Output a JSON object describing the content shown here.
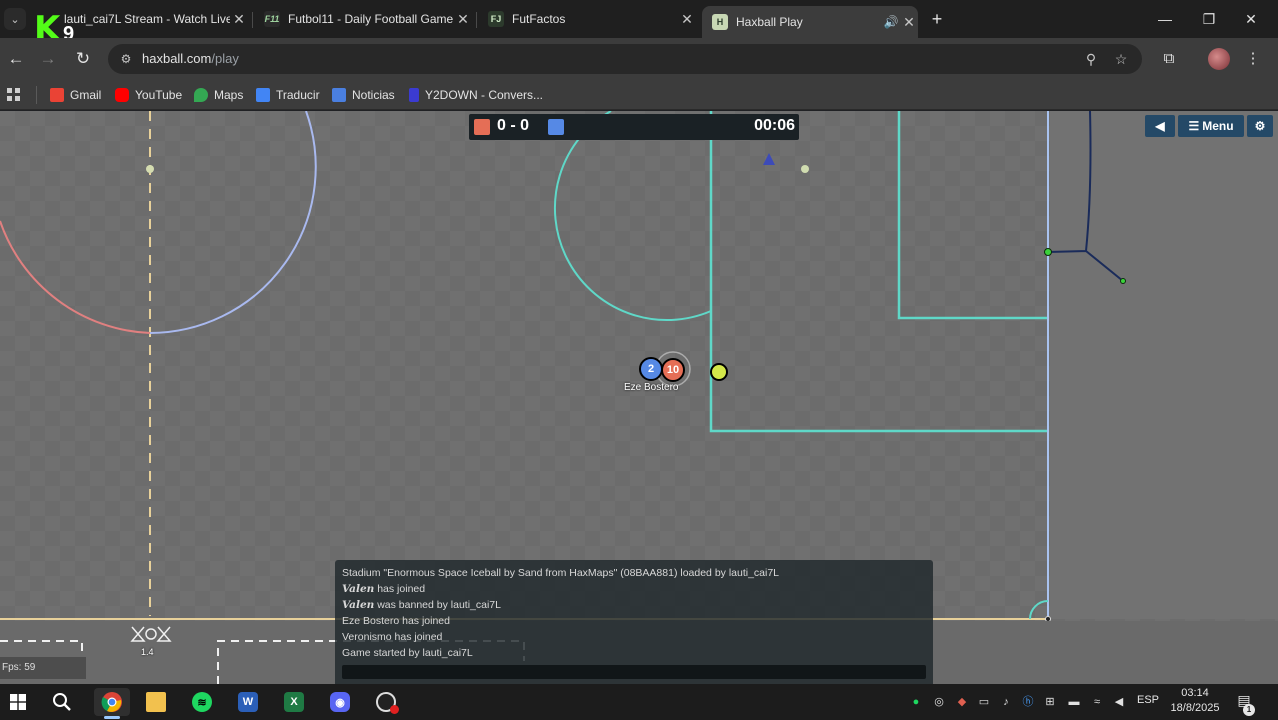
{
  "browser": {
    "tabs": [
      {
        "title": "lauti_cai7L Stream - Watch Live",
        "favicon": "kick-icon",
        "active": false
      },
      {
        "title": "Futbol11 - Daily Football Game",
        "favicon": "futbol11-icon",
        "active": false
      },
      {
        "title": "FutFactos",
        "favicon": "futfactos-icon",
        "active": false
      },
      {
        "title": "Haxball Play",
        "favicon": "haxball-icon",
        "active": true
      }
    ],
    "overlay_number": "9",
    "url_host": "haxball.com",
    "url_path": "/play",
    "bookmarks": [
      {
        "label": "Gmail",
        "color": "#ea4335"
      },
      {
        "label": "YouTube",
        "color": "#ff0000"
      },
      {
        "label": "Maps",
        "color": "#34a853"
      },
      {
        "label": "Traducir",
        "color": "#4285f4"
      },
      {
        "label": "Noticias",
        "color": "#4a7fe0"
      },
      {
        "label": "Y2DOWN - Convers...",
        "color": "#3b3bd1"
      }
    ]
  },
  "game": {
    "score": "0 - 0",
    "timer": "00:06",
    "red_color": "#e56e56",
    "blue_color": "#5689e5",
    "menu_label": "Menu",
    "fps": "Fps: 59",
    "players": [
      {
        "number": "2",
        "team": "blue",
        "name": "Eze Bostero"
      },
      {
        "number": "10",
        "team": "red",
        "name": ""
      }
    ],
    "field_text": "1.4",
    "chat": [
      {
        "text": "Stadium \"Enormous Space Iceball by Sand from HaxMaps\" (08BAA881) loaded by lauti_cai7L"
      },
      {
        "fancy": "Valen",
        "text": " has joined"
      },
      {
        "fancy": "Valen",
        "text": " was banned by lauti_cai7L"
      },
      {
        "text": "Eze Bostero has joined"
      },
      {
        "text": "Veronismo has joined"
      },
      {
        "text": "Game started by lauti_cai7L"
      }
    ]
  },
  "taskbar": {
    "apps": [
      "windows-start",
      "search",
      "chrome",
      "file-explorer",
      "spotify",
      "word",
      "excel",
      "discord",
      "obs"
    ],
    "language": "ESP",
    "time": "03:14",
    "date": "18/8/2025",
    "notification_count": "1"
  }
}
